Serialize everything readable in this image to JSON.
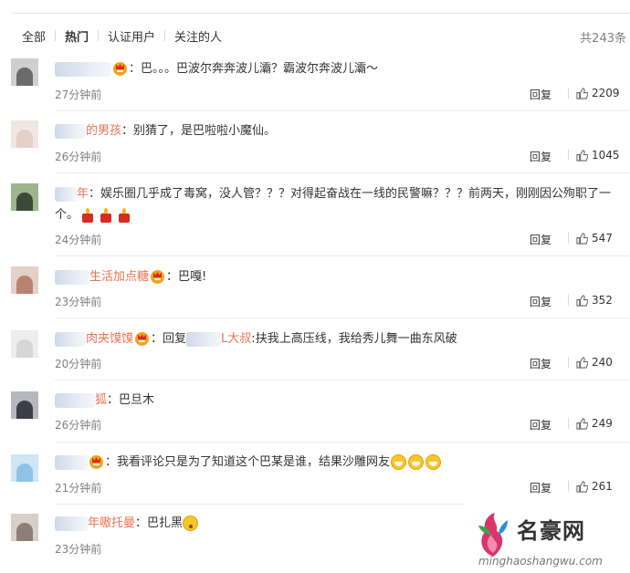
{
  "tabs": [
    "全部",
    "热门",
    "认证用户",
    "关注的人"
  ],
  "active_tab": "热门",
  "total_count": "共243条",
  "reply_label": "回复",
  "colors": {
    "username": "#eb7350",
    "vip_badge": "#f4a21a",
    "candle": "#d72b1f"
  },
  "comments": [
    {
      "name_visible": "",
      "text": "巴。。。巴波尔奔奔波儿灞？霸波尔奔波儿灞～",
      "time": "27分钟前",
      "likes": "2209"
    },
    {
      "name_visible": "的男孩",
      "text": "别猜了，是巴啦啦小魔仙。",
      "time": "26分钟前",
      "likes": "1045"
    },
    {
      "name_visible": "年",
      "text": "娱乐圈几乎成了毒窝，没人管？？？对得起奋战在一线的民警嘛？？？前两天，刚刚因公殉职了一",
      "text2": "个。",
      "time": "24分钟前",
      "likes": "547"
    },
    {
      "name_visible": "生活加点糖",
      "text": "巴嘎!",
      "time": "23分钟前",
      "likes": "352"
    },
    {
      "name_visible": "肉夹馍馍",
      "reply_prefix": "回复",
      "reply_to": "L大叔",
      "text": "扶我上高压线，我给秀儿舞一曲东风破",
      "time": "20分钟前",
      "likes": "240"
    },
    {
      "name_visible": "狐",
      "text": "巴旦木",
      "time": "26分钟前",
      "likes": "249"
    },
    {
      "name_visible": "",
      "text": "我看评论只是为了知道这个巴某是谁，结果沙雕网友",
      "time": "21分钟前",
      "likes": "261"
    },
    {
      "name_visible": "年嗷托曼",
      "text": "巴扎黑",
      "time": "23分钟前",
      "likes": ""
    }
  ],
  "watermark": {
    "name": "名豪网",
    "url": "minghaoshangwu.com"
  }
}
